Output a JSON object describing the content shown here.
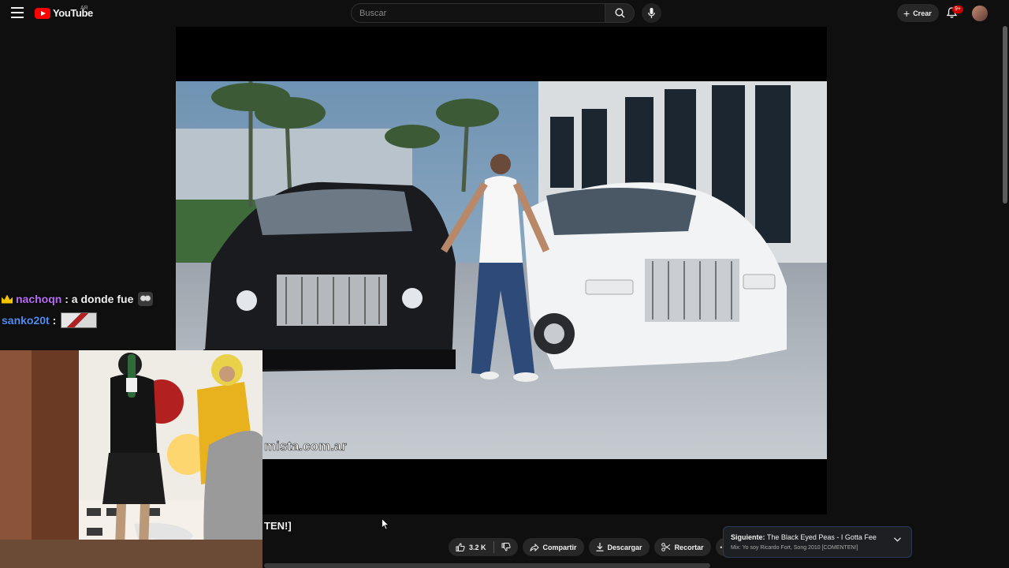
{
  "header": {
    "logo_text": "YouTube",
    "country_code": "AR",
    "search_placeholder": "Buscar",
    "create_label": "Crear",
    "notification_badge": "9+"
  },
  "chat": [
    {
      "user": "nachoqn",
      "separator": ":",
      "message": "a donde fue",
      "user_color": "#b86cf5",
      "badge": "crown-icon"
    },
    {
      "user": "sanko20t",
      "separator": ":",
      "message": "",
      "user_color": "#4f8df0"
    }
  ],
  "video": {
    "watermark_text": "mista.com.ar",
    "title_fragment": "TEN!]"
  },
  "actions": {
    "like_count": "3.2 K",
    "share_label": "Compartir",
    "download_label": "Descargar",
    "clip_label": "Recortar"
  },
  "up_next": {
    "prefix": "Siguiente:",
    "title": "The Black Eyed Peas - I Gotta Feeling (O...",
    "subtitle": "Mix: Yo soy Ricardo Fort, Song 2010 [COMENTEN!]"
  },
  "colors": {
    "accent": "#ff0000",
    "badge": "#cc0000",
    "background": "#0f0f0f"
  }
}
